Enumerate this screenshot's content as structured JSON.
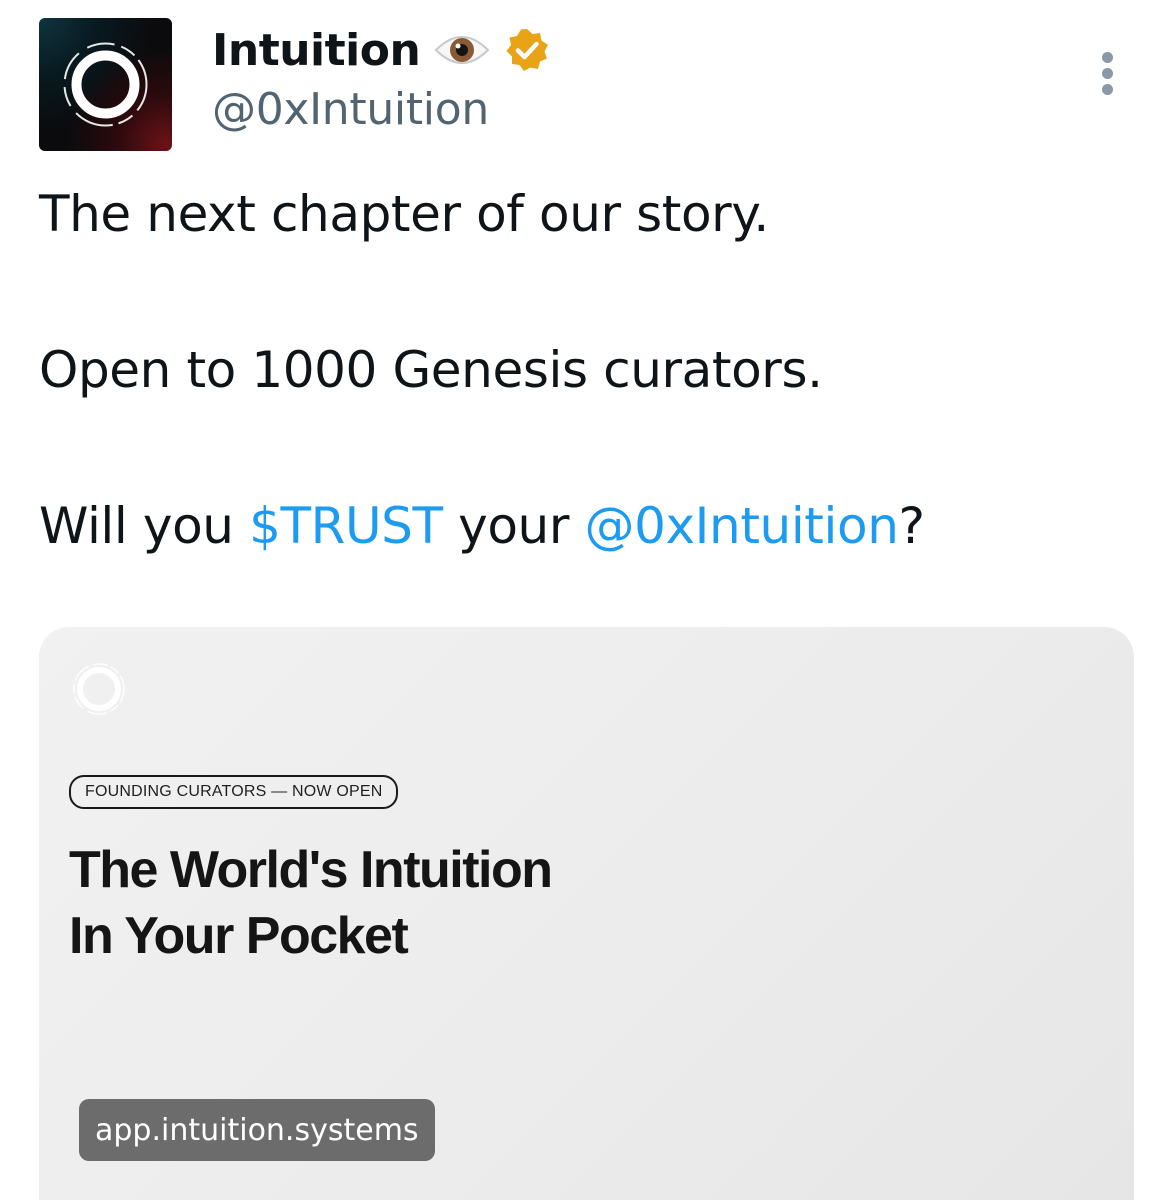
{
  "author": {
    "display_name": "Intuition",
    "handle": "@0xIntuition",
    "avatar_icon": "intuition-ring-logo",
    "badges": [
      "eye-emoji",
      "verified-badge"
    ],
    "verified_badge_color": "#e8a317"
  },
  "tweet": {
    "line1": "The next chapter of our story.",
    "line2": "Open to 1000 Genesis curators.",
    "line3": {
      "prefix": "Will you ",
      "cashtag": "$TRUST",
      "middle": " your ",
      "mention": "@0xIntuition",
      "suffix": "?"
    },
    "link_color": "#1d9bf0"
  },
  "card": {
    "logo_icon": "intuition-ring-logo",
    "badge": "FOUNDING CURATORS — NOW OPEN",
    "heading_line1": "The World's Intuition",
    "heading_line2": "In Your Pocket",
    "domain": "app.intuition.systems"
  }
}
